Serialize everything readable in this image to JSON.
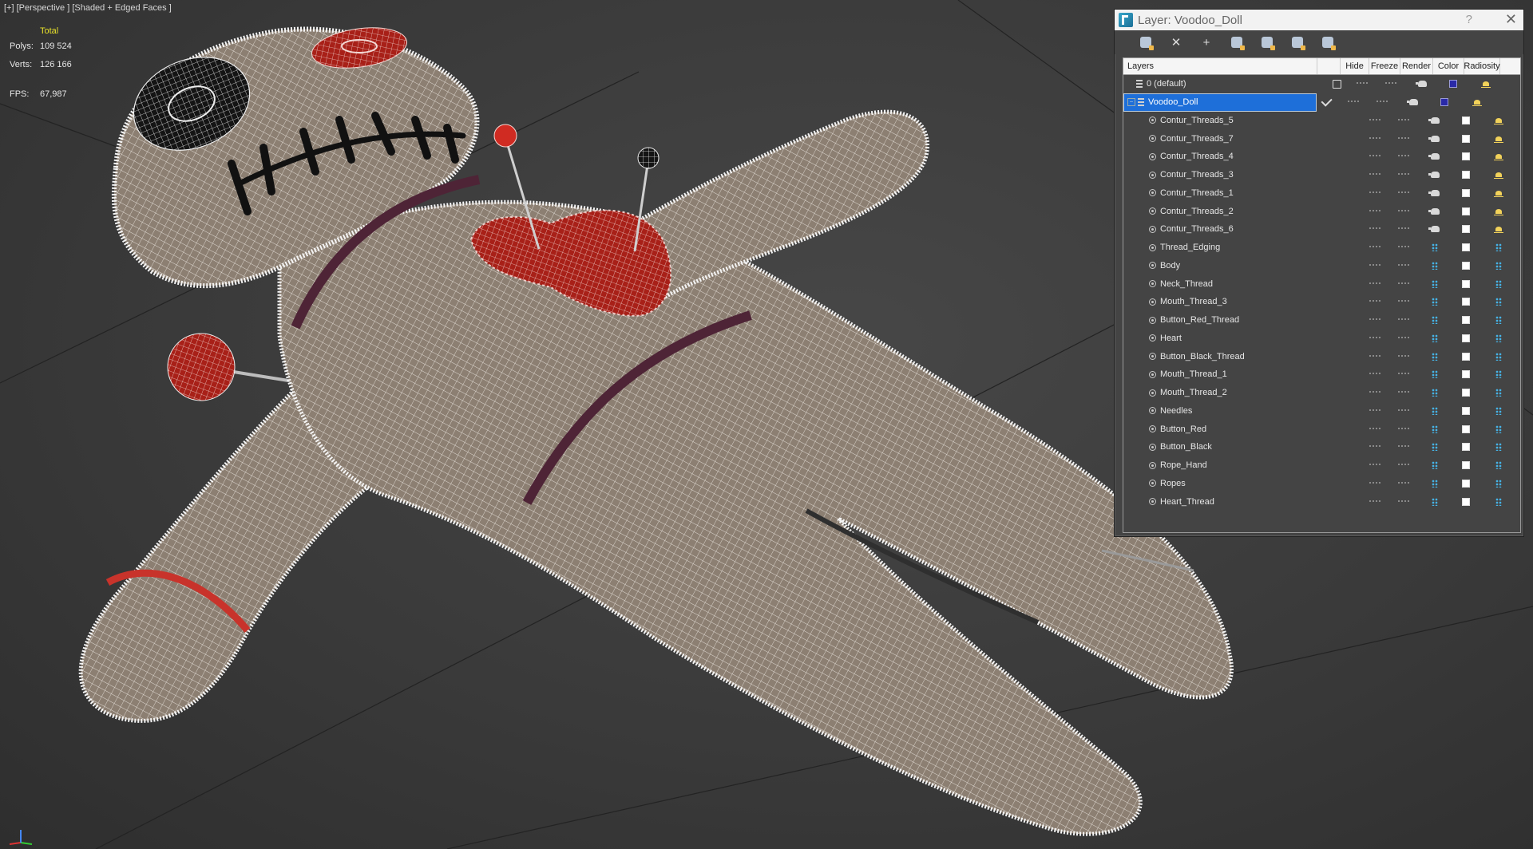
{
  "viewport": {
    "label_parts": [
      "[+]",
      "[Perspective ]",
      "[Shaded + Edged Faces ]"
    ],
    "stats": {
      "header": "Total",
      "polys_label": "Polys:",
      "polys_value": "109 524",
      "verts_label": "Verts:",
      "verts_value": "126 166",
      "fps_label": "FPS:",
      "fps_value": "67,987"
    }
  },
  "layer_window": {
    "title": "Layer: Voodoo_Doll",
    "help_label": "?",
    "close_label": "✕",
    "toolbar": [
      {
        "name": "create-layer-icon"
      },
      {
        "name": "delete-layer-icon",
        "glyph": "✕"
      },
      {
        "name": "add-to-layer-icon",
        "glyph": "+"
      },
      {
        "name": "select-objects-icon"
      },
      {
        "name": "highlight-layer-icon"
      },
      {
        "name": "hide-all-icon"
      },
      {
        "name": "freeze-all-icon"
      }
    ],
    "columns": {
      "layers": "Layers",
      "hide": "Hide",
      "freeze": "Freeze",
      "render": "Render",
      "color": "Color",
      "radiosity": "Radiosity"
    },
    "rows": [
      {
        "label": "0 (default)",
        "kind": "layer",
        "current": false,
        "color": "blue"
      },
      {
        "label": "Voodoo_Doll",
        "kind": "layer",
        "current": true,
        "selected": true,
        "color": "blue"
      },
      {
        "label": "Contur_Threads_5",
        "kind": "object",
        "render": "teapot",
        "rad": "sun"
      },
      {
        "label": "Contur_Threads_7",
        "kind": "object",
        "render": "teapot",
        "rad": "sun"
      },
      {
        "label": "Contur_Threads_4",
        "kind": "object",
        "render": "teapot",
        "rad": "sun"
      },
      {
        "label": "Contur_Threads_3",
        "kind": "object",
        "render": "teapot",
        "rad": "sun"
      },
      {
        "label": "Contur_Threads_1",
        "kind": "object",
        "render": "teapot",
        "rad": "sun"
      },
      {
        "label": "Contur_Threads_2",
        "kind": "object",
        "render": "teapot",
        "rad": "sun"
      },
      {
        "label": "Contur_Threads_6",
        "kind": "object",
        "render": "teapot",
        "rad": "sun"
      },
      {
        "label": "Thread_Edging",
        "kind": "object",
        "render": "dots",
        "rad": "dots"
      },
      {
        "label": "Body",
        "kind": "object",
        "render": "dots",
        "rad": "dots"
      },
      {
        "label": "Neck_Thread",
        "kind": "object",
        "render": "dots",
        "rad": "dots"
      },
      {
        "label": "Mouth_Thread_3",
        "kind": "object",
        "render": "dots",
        "rad": "dots"
      },
      {
        "label": "Button_Red_Thread",
        "kind": "object",
        "render": "dots",
        "rad": "dots"
      },
      {
        "label": "Heart",
        "kind": "object",
        "render": "dots",
        "rad": "dots"
      },
      {
        "label": "Button_Black_Thread",
        "kind": "object",
        "render": "dots",
        "rad": "dots"
      },
      {
        "label": "Mouth_Thread_1",
        "kind": "object",
        "render": "dots",
        "rad": "dots"
      },
      {
        "label": "Mouth_Thread_2",
        "kind": "object",
        "render": "dots",
        "rad": "dots"
      },
      {
        "label": "Needles",
        "kind": "object",
        "render": "dots",
        "rad": "dots"
      },
      {
        "label": "Button_Red",
        "kind": "object",
        "render": "dots",
        "rad": "dots"
      },
      {
        "label": "Button_Black",
        "kind": "object",
        "render": "dots",
        "rad": "dots"
      },
      {
        "label": "Rope_Hand",
        "kind": "object",
        "render": "dots",
        "rad": "dots"
      },
      {
        "label": "Ropes",
        "kind": "object",
        "render": "dots",
        "rad": "dots"
      },
      {
        "label": "Heart_Thread",
        "kind": "object",
        "render": "dots",
        "rad": "dots"
      }
    ]
  },
  "colors": {
    "viewport_bg": "#3a3a3a",
    "selection": "#1e6fd9",
    "stats_text": "#e7e02a",
    "doll_fabric": "#8f8275",
    "wire": "#f2f2f2",
    "heart_red": "#b3261e",
    "button_black": "#1a1a1a",
    "rope_purple": "#5a2a3d"
  }
}
